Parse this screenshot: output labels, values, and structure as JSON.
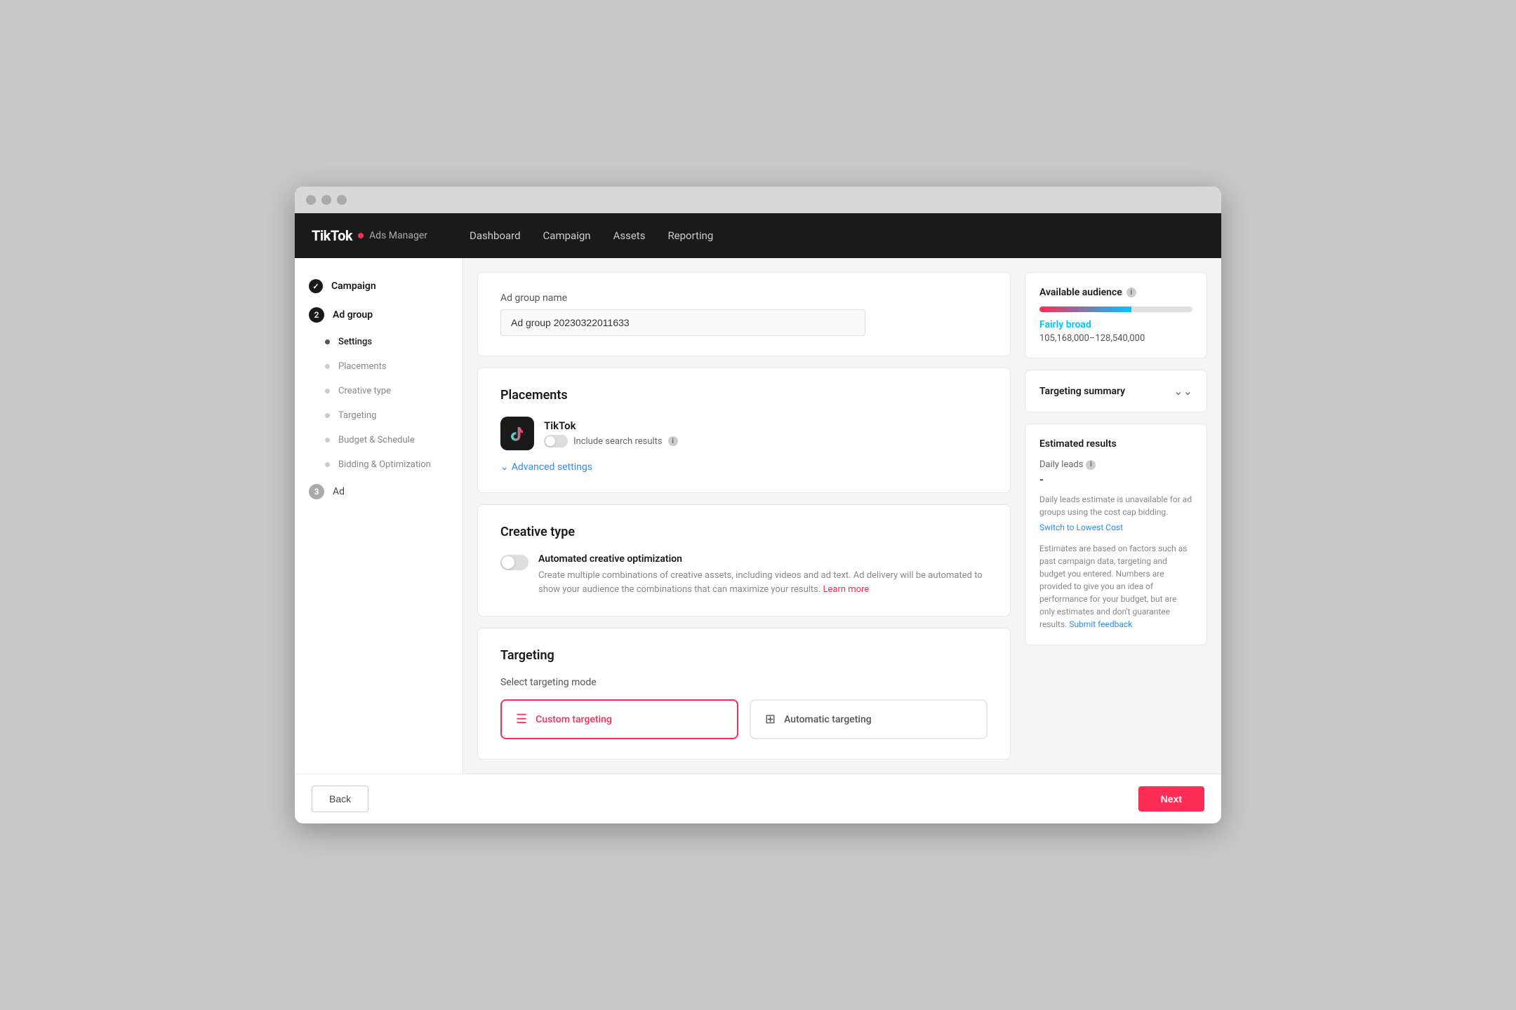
{
  "browser": {
    "dots": [
      "dot1",
      "dot2",
      "dot3"
    ]
  },
  "nav": {
    "logo_main": "TikTok",
    "logo_sub": "Ads Manager",
    "links": [
      {
        "id": "dashboard",
        "label": "Dashboard"
      },
      {
        "id": "campaign",
        "label": "Campaign"
      },
      {
        "id": "assets",
        "label": "Assets"
      },
      {
        "id": "reporting",
        "label": "Reporting"
      }
    ]
  },
  "sidebar": {
    "items": [
      {
        "id": "campaign",
        "label": "Campaign",
        "type": "check"
      },
      {
        "id": "ad-group",
        "label": "Ad group",
        "type": "number",
        "num": "2"
      },
      {
        "id": "settings",
        "label": "Settings",
        "type": "dot-dark"
      },
      {
        "id": "placements",
        "label": "Placements",
        "type": "dot"
      },
      {
        "id": "creative-type",
        "label": "Creative type",
        "type": "dot"
      },
      {
        "id": "targeting",
        "label": "Targeting",
        "type": "dot"
      },
      {
        "id": "budget-schedule",
        "label": "Budget & Schedule",
        "type": "dot"
      },
      {
        "id": "bidding-optimization",
        "label": "Bidding & Optimization",
        "type": "dot"
      },
      {
        "id": "ad",
        "label": "Ad",
        "type": "number-gray",
        "num": "3"
      }
    ]
  },
  "ad_group_name_section": {
    "label": "Ad group name",
    "value": "Ad group 20230322011633"
  },
  "placements_section": {
    "title": "Placements",
    "platform": "TikTok",
    "toggle_label": "Include search results",
    "advanced_settings": "Advanced settings"
  },
  "creative_type_section": {
    "title": "Creative type",
    "toggle_title": "Automated creative optimization",
    "toggle_desc": "Create multiple combinations of creative assets, including videos and ad text. Ad delivery will be automated to show your audience the combinations that can maximize your results.",
    "learn_more": "Learn more"
  },
  "targeting_section": {
    "title": "Targeting",
    "mode_label": "Select targeting mode",
    "options": [
      {
        "id": "custom",
        "label": "Custom targeting",
        "selected": true
      },
      {
        "id": "automatic",
        "label": "Automatic targeting",
        "selected": false
      }
    ]
  },
  "right_panel": {
    "available_audience": {
      "title": "Available audience",
      "breadth": "Fairly broad",
      "range": "105,168,000–128,540,000"
    },
    "targeting_summary": {
      "title": "Targeting summary"
    },
    "estimated_results": {
      "title": "Estimated results",
      "daily_leads_label": "Daily leads",
      "dash": "-",
      "note": "Daily leads estimate is unavailable for ad groups using the cost cap bidding.",
      "switch_link": "Switch to Lowest Cost",
      "estimates_note": "Estimates are based on factors such as past campaign data, targeting and budget you entered. Numbers are provided to give you an idea of performance for your budget, but are only estimates and don't guarantee results.",
      "submit_feedback": "Submit feedback"
    }
  },
  "bottom_bar": {
    "back_label": "Back",
    "next_label": "Next"
  }
}
